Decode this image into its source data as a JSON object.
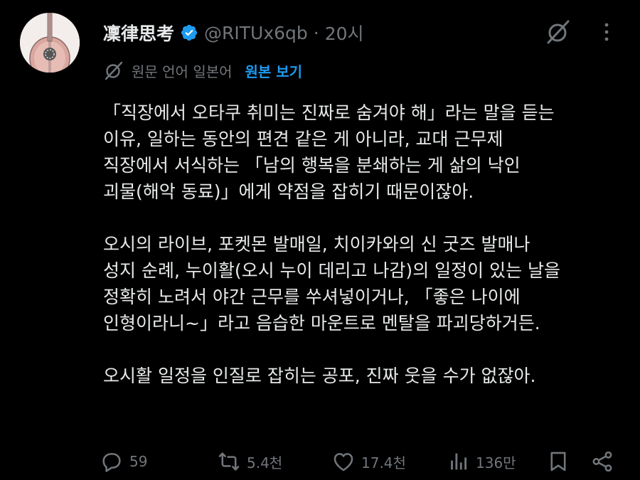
{
  "post": {
    "author_name": "凜律思考",
    "handle": "@RITUx6qb",
    "separator": "·",
    "time": "20시",
    "translation_note": "원문 언어 일본어",
    "show_original": "원본 보기",
    "paragraphs": [
      "「직장에서 오타쿠 취미는 진짜로 숨겨야 해」라는 말을 듣는\n이유, 일하는 동안의 편견 같은 게 아니라, 교대 근무제\n직장에서 서식하는 「남의 행복을 분쇄하는 게 삶의 낙인\n괴물(해악 동료)」에게 약점을 잡히기 때문이잖아.",
      "오시의 라이브, 포켓몬 발매일, 치이카와의 신 굿즈 발매나\n성지 순례, 누이활(오시 누이 데리고 나감)의 일정이 있는 날을\n정확히 노려서 야간 근무를 쑤셔넣이거나, 「좋은 나이에\n인형이라니~」라고 음습한 마운트로 멘탈을 파괴당하거든.",
      "오시활 일정을 인질로 잡히는 공포, 진짜 웃을 수가 없잖아."
    ]
  },
  "actions": {
    "reply_count": "59",
    "repost_count": "5.4천",
    "like_count": "17.4천",
    "views_count": "136만"
  },
  "colors": {
    "background": "#000000",
    "text": "#e7e9ea",
    "muted": "#71767b",
    "accent": "#1d9bf0"
  },
  "icons": [
    "verified-badge-icon",
    "grok-icon",
    "more-icon",
    "translate-icon",
    "reply-icon",
    "repost-icon",
    "like-icon",
    "views-icon",
    "bookmark-icon",
    "share-icon"
  ]
}
